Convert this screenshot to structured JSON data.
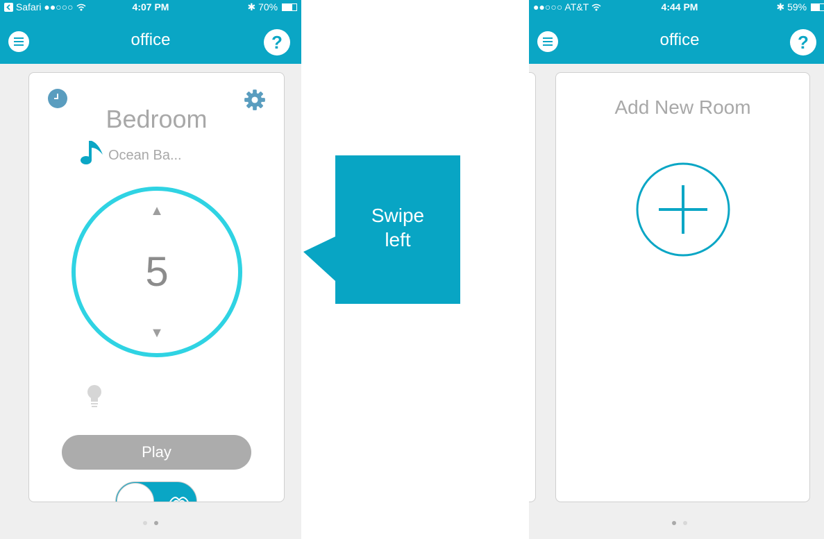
{
  "left_screen": {
    "status": {
      "carrier": "Safari",
      "time": "4:07 PM",
      "battery": "70%",
      "battery_level": 0.7
    },
    "title": "office",
    "help_label": "?",
    "room": {
      "name": "Bedroom",
      "track": "Ocean Ba...",
      "level": "5",
      "up_arrow": "▲",
      "down_arrow": "▼",
      "play_label": "Play"
    },
    "pager_active_index": 1
  },
  "callout": {
    "line1": "Swipe",
    "line2": "left"
  },
  "right_screen": {
    "status": {
      "carrier": "AT&T",
      "time": "4:44 PM",
      "battery": "59%",
      "battery_level": 0.59
    },
    "title": "office",
    "help_label": "?",
    "add_room_label": "Add New Room",
    "pager_active_index": 0
  },
  "colors": {
    "brand": "#0aa6c5",
    "dial": "#2fd3e3",
    "gear": "#5a9dbf",
    "play": "#acacac"
  },
  "icons": [
    "menu-icon",
    "help-icon",
    "clock-icon",
    "gear-icon",
    "music-note-icon",
    "lightbulb-icon",
    "plus-icon",
    "wifi-icon",
    "bluetooth-icon",
    "battery-icon",
    "back-arrow-icon"
  ]
}
